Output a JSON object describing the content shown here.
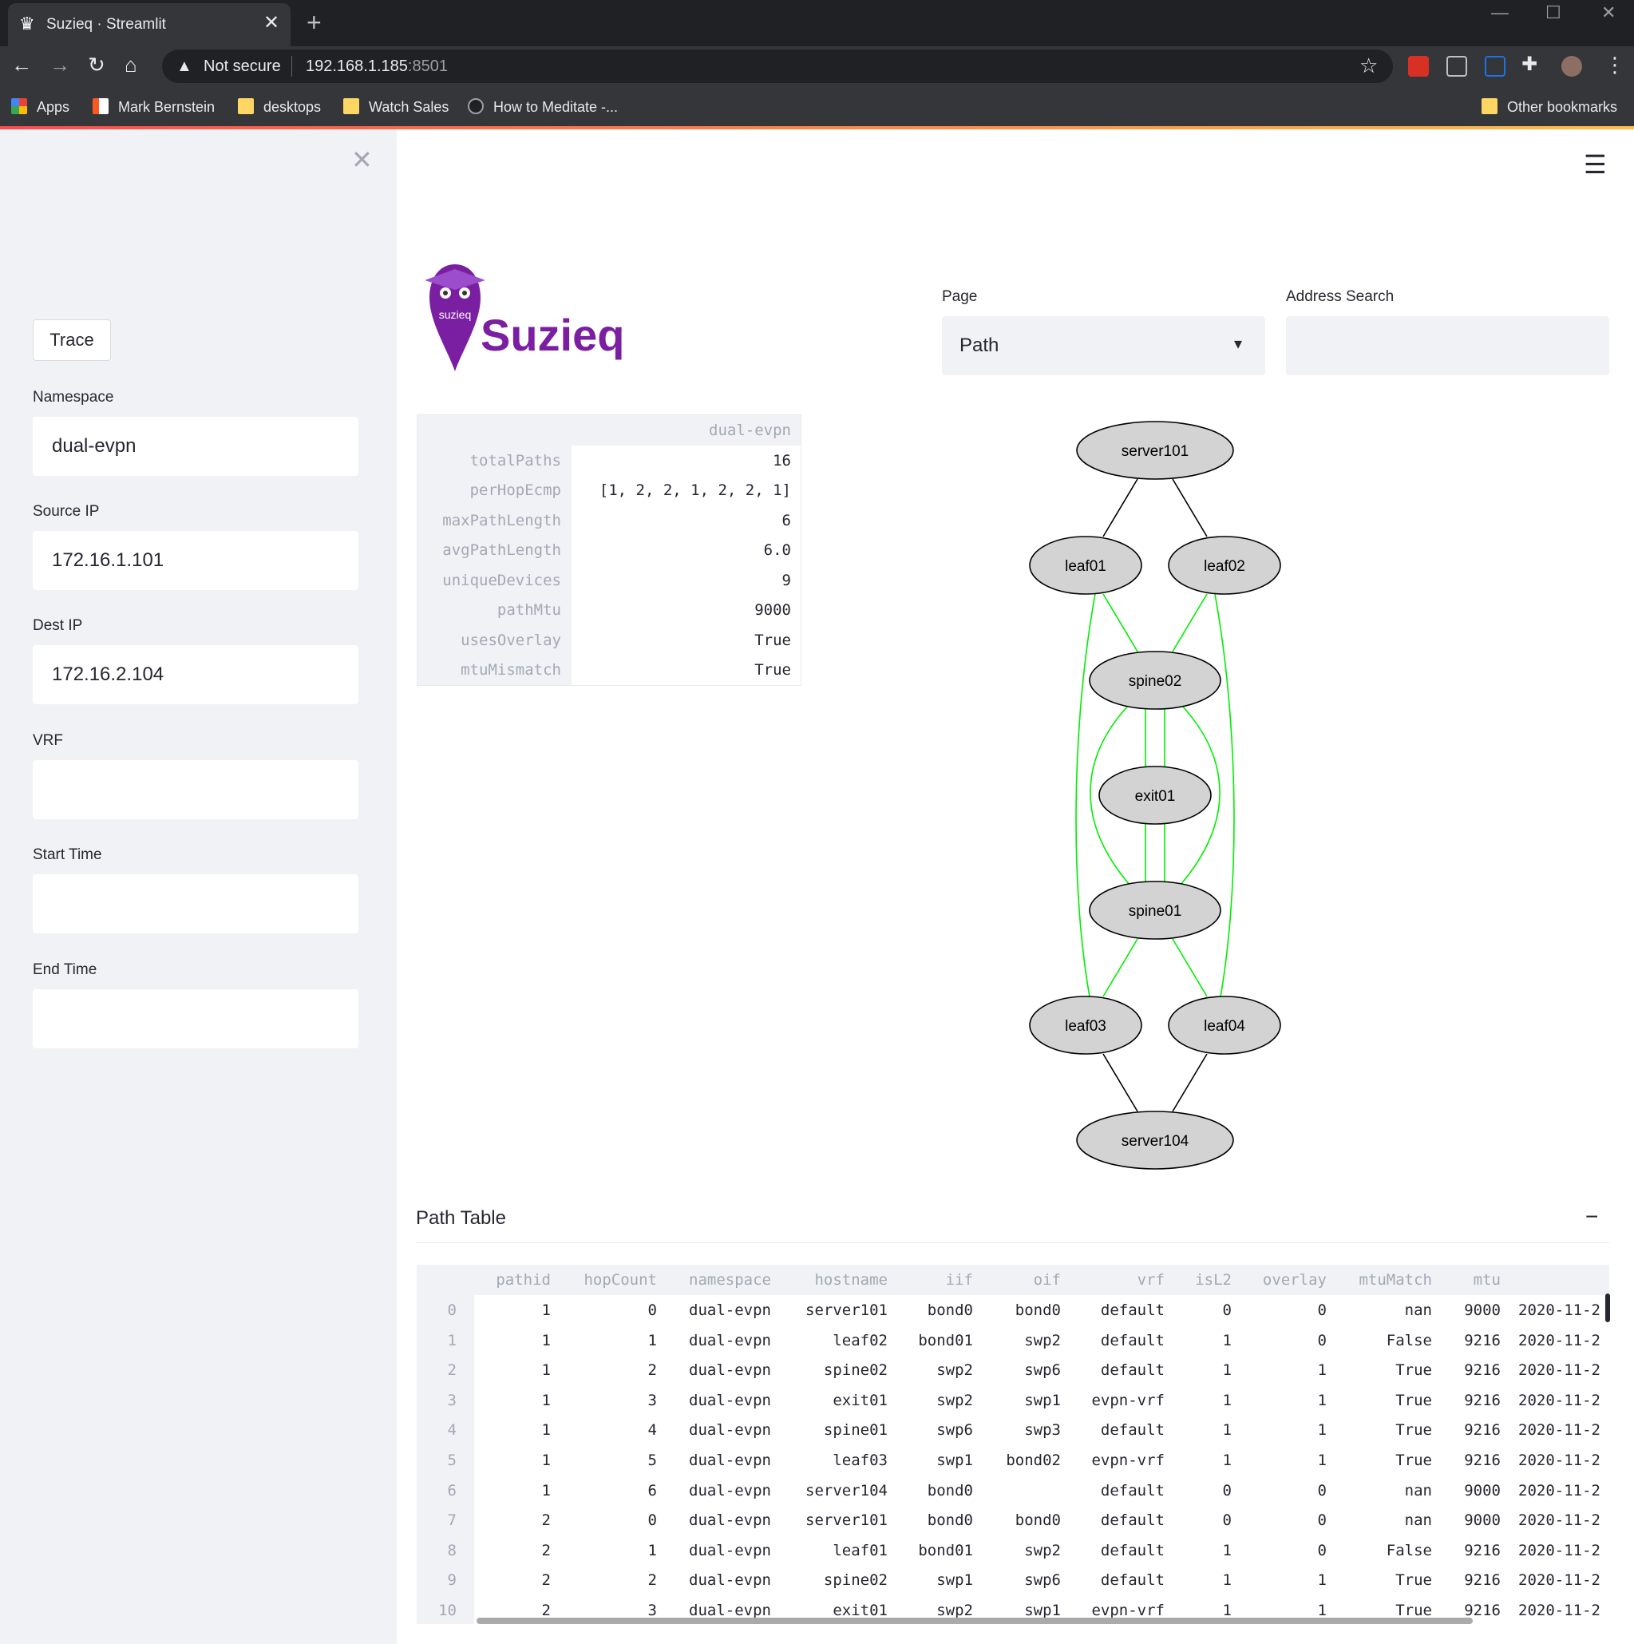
{
  "browser": {
    "tab_title": "Suzieq · Streamlit",
    "security_label": "Not secure",
    "url_host": "192.168.1.185",
    "url_port": ":8501",
    "bookmarks": [
      {
        "label": "Apps",
        "icon": "apps-grid-icon"
      },
      {
        "label": "Mark Bernstein",
        "icon": "bookmark-favicon-icon"
      },
      {
        "label": "desktops",
        "icon": "folder-icon"
      },
      {
        "label": "Watch Sales",
        "icon": "folder-icon"
      },
      {
        "label": "How to Meditate -...",
        "icon": "nyt-favicon-icon"
      }
    ],
    "other_bookmarks": "Other bookmarks"
  },
  "sidebar": {
    "trace_button": "Trace",
    "fields": [
      {
        "label": "Namespace",
        "value": "dual-evpn"
      },
      {
        "label": "Source IP",
        "value": "172.16.1.101"
      },
      {
        "label": "Dest IP",
        "value": "172.16.2.104"
      },
      {
        "label": "VRF",
        "value": ""
      },
      {
        "label": "Start Time",
        "value": ""
      },
      {
        "label": "End Time",
        "value": ""
      }
    ]
  },
  "brand": {
    "name": "Suzieq",
    "logo_text": "suzieq",
    "color": "#7b1fa2"
  },
  "controls": {
    "page_label": "Page",
    "page_value": "Path",
    "address_label": "Address Search",
    "address_value": ""
  },
  "summary": {
    "column": "dual-evpn",
    "rows": [
      {
        "key": "totalPaths",
        "value": "16"
      },
      {
        "key": "perHopEcmp",
        "value": "[1, 2, 2, 1, 2, 2, 1]"
      },
      {
        "key": "maxPathLength",
        "value": "6"
      },
      {
        "key": "avgPathLength",
        "value": "6.0"
      },
      {
        "key": "uniqueDevices",
        "value": "9"
      },
      {
        "key": "pathMtu",
        "value": "9000"
      },
      {
        "key": "usesOverlay",
        "value": "True"
      },
      {
        "key": "mtuMismatch",
        "value": "True"
      }
    ]
  },
  "graph": {
    "nodes": [
      "server101",
      "leaf01",
      "leaf02",
      "spine02",
      "exit01",
      "spine01",
      "leaf03",
      "leaf04",
      "server104"
    ],
    "edge_colors": {
      "underlay": "#000000",
      "overlay": "#00ee00"
    }
  },
  "path_table": {
    "title": "Path Table",
    "collapse_icon": "minus-icon",
    "columns": [
      "pathid",
      "hopCount",
      "namespace",
      "hostname",
      "iif",
      "oif",
      "vrf",
      "isL2",
      "overlay",
      "mtuMatch",
      "mtu"
    ],
    "rows": [
      [
        "0",
        "1",
        "0",
        "dual-evpn",
        "server101",
        "bond0",
        "bond0",
        "default",
        "0",
        "0",
        "nan",
        "9000",
        "2020-11-2"
      ],
      [
        "1",
        "1",
        "1",
        "dual-evpn",
        "leaf02",
        "bond01",
        "swp2",
        "default",
        "1",
        "0",
        "False",
        "9216",
        "2020-11-2"
      ],
      [
        "2",
        "1",
        "2",
        "dual-evpn",
        "spine02",
        "swp2",
        "swp6",
        "default",
        "1",
        "1",
        "True",
        "9216",
        "2020-11-2"
      ],
      [
        "3",
        "1",
        "3",
        "dual-evpn",
        "exit01",
        "swp2",
        "swp1",
        "evpn-vrf",
        "1",
        "1",
        "True",
        "9216",
        "2020-11-2"
      ],
      [
        "4",
        "1",
        "4",
        "dual-evpn",
        "spine01",
        "swp6",
        "swp3",
        "default",
        "1",
        "1",
        "True",
        "9216",
        "2020-11-2"
      ],
      [
        "5",
        "1",
        "5",
        "dual-evpn",
        "leaf03",
        "swp1",
        "bond02",
        "evpn-vrf",
        "1",
        "1",
        "True",
        "9216",
        "2020-11-2"
      ],
      [
        "6",
        "1",
        "6",
        "dual-evpn",
        "server104",
        "bond0",
        "",
        "default",
        "0",
        "0",
        "nan",
        "9000",
        "2020-11-2"
      ],
      [
        "7",
        "2",
        "0",
        "dual-evpn",
        "server101",
        "bond0",
        "bond0",
        "default",
        "0",
        "0",
        "nan",
        "9000",
        "2020-11-2"
      ],
      [
        "8",
        "2",
        "1",
        "dual-evpn",
        "leaf01",
        "bond01",
        "swp2",
        "default",
        "1",
        "0",
        "False",
        "9216",
        "2020-11-2"
      ],
      [
        "9",
        "2",
        "2",
        "dual-evpn",
        "spine02",
        "swp1",
        "swp6",
        "default",
        "1",
        "1",
        "True",
        "9216",
        "2020-11-2"
      ],
      [
        "10",
        "2",
        "3",
        "dual-evpn",
        "exit01",
        "swp2",
        "swp1",
        "evpn-vrf",
        "1",
        "1",
        "True",
        "9216",
        "2020-11-2"
      ]
    ]
  }
}
